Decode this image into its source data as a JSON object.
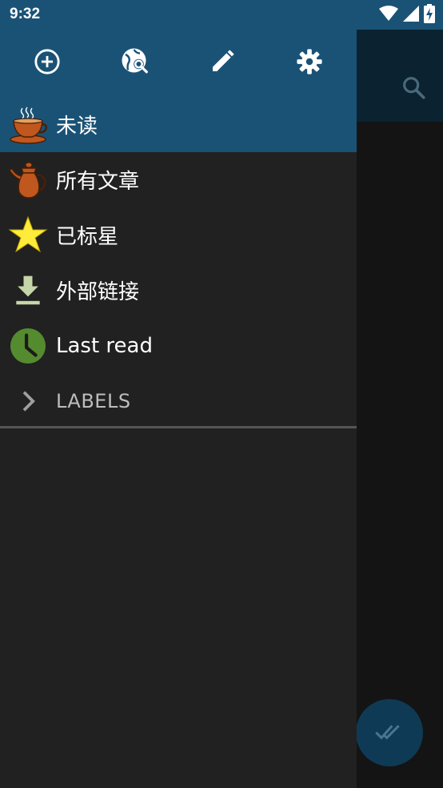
{
  "status_bar": {
    "time": "9:32",
    "icons": [
      "wifi-icon",
      "signal-icon",
      "battery-charging-icon"
    ]
  },
  "drawer": {
    "header_actions": [
      {
        "name": "add-feed-button",
        "icon": "add-circle-icon"
      },
      {
        "name": "search-feed-button",
        "icon": "globe-search-icon"
      },
      {
        "name": "edit-button",
        "icon": "pencil-icon"
      },
      {
        "name": "settings-button",
        "icon": "gear-icon"
      }
    ],
    "items": [
      {
        "label": "未读",
        "icon": "coffee-cup-icon",
        "selected": true
      },
      {
        "label": "所有文章",
        "icon": "coffee-pot-icon",
        "selected": false
      },
      {
        "label": "已标星",
        "icon": "star-icon",
        "selected": false
      },
      {
        "label": "外部链接",
        "icon": "download-icon",
        "selected": false
      },
      {
        "label": "Last read",
        "icon": "clock-icon",
        "selected": false
      }
    ],
    "labels_section": {
      "label": "LABELS",
      "icon": "chevron-right-icon"
    }
  },
  "background_app": {
    "toolbar_icon": "search-icon",
    "fab_icon": "mark-all-read-icon"
  },
  "colors": {
    "header_blue": "#1a5276",
    "drawer_bg": "#212121",
    "star_yellow": "#ffeb3b",
    "clock_green": "#558b2f",
    "download_green": "#c5d6a8",
    "coffee_orange": "#c0571e"
  }
}
